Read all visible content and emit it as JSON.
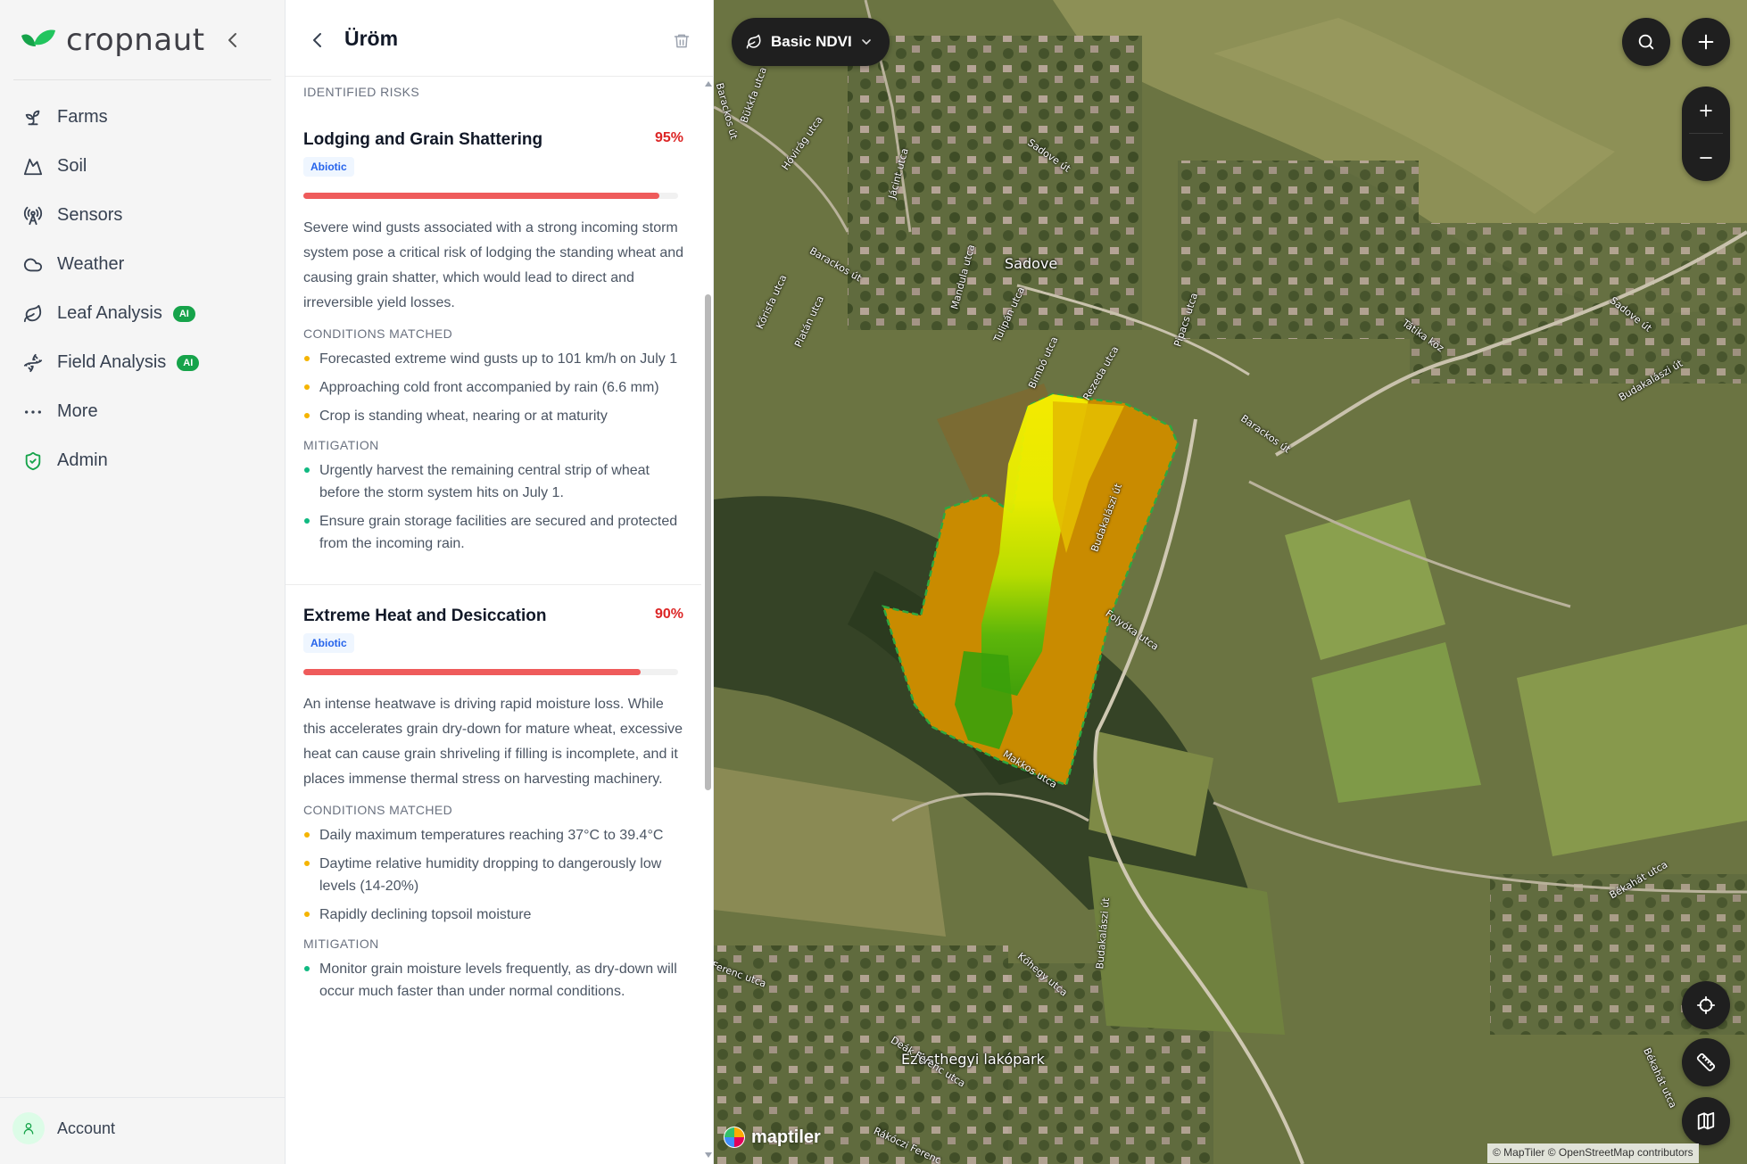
{
  "app": {
    "logo_text": "cropnaut",
    "brand_color": "#16a34a"
  },
  "sidebar": {
    "items": [
      {
        "label": "Farms",
        "icon": "sprout-icon"
      },
      {
        "label": "Soil",
        "icon": "mountain-icon"
      },
      {
        "label": "Sensors",
        "icon": "radio-tower-icon"
      },
      {
        "label": "Weather",
        "icon": "cloud-icon"
      },
      {
        "label": "Leaf Analysis",
        "icon": "leaf-icon",
        "badge": "AI"
      },
      {
        "label": "Field Analysis",
        "icon": "dna-icon",
        "badge": "AI"
      },
      {
        "label": "More",
        "icon": "more-dots-icon"
      },
      {
        "label": "Admin",
        "icon": "shield-check-icon"
      }
    ],
    "account_label": "Account"
  },
  "panel": {
    "title": "Üröm",
    "section_label": "IDENTIFIED RISKS",
    "conditions_label": "CONDITIONS MATCHED",
    "mitigation_label": "MITIGATION",
    "risks": [
      {
        "title": "Lodging and Grain Shattering",
        "percent": "95%",
        "tag": "Abiotic",
        "description": "Severe wind gusts associated with a strong incoming storm system pose a critical risk of lodging the standing wheat and causing grain shatter, which would lead to direct and irreversible yield losses.",
        "conditions": [
          "Forecasted extreme wind gusts up to 101 km/h on July 1",
          "Approaching cold front accompanied by rain (6.6 mm)",
          "Crop is standing wheat, nearing or at maturity"
        ],
        "mitigation": [
          "Urgently harvest the remaining central strip of wheat before the storm system hits on July 1.",
          "Ensure grain storage facilities are secured and protected from the incoming rain."
        ]
      },
      {
        "title": "Extreme Heat and Desiccation",
        "percent": "90%",
        "tag": "Abiotic",
        "description": "An intense heatwave is driving rapid moisture loss. While this accelerates grain dry-down for mature wheat, excessive heat can cause grain shriveling if filling is incomplete, and it places immense thermal stress on harvesting machinery.",
        "conditions": [
          "Daily maximum temperatures reaching 37°C to 39.4°C",
          "Daytime relative humidity dropping to dangerously low levels (14-20%)",
          "Rapidly declining topsoil moisture"
        ],
        "mitigation": [
          "Monitor grain moisture levels frequently, as dry-down will occur much faster than under normal conditions."
        ]
      }
    ]
  },
  "map": {
    "layer_label": "Basic NDVI",
    "attribution": "© MapTiler © OpenStreetMap contributors",
    "logo_text": "maptiler",
    "place_labels": [
      "Sadove",
      "Ezüsthegyi lakópark"
    ],
    "street_labels": [
      "Barackos út",
      "Bükkfa utca",
      "Hóvirág utca",
      "Sadove út",
      "Jácint utca",
      "Barackos út",
      "Mandula utca",
      "Tulipán utca",
      "Kőrisfa utca",
      "Platán utca",
      "Bimbó utca",
      "Rezeda utca",
      "Pipacs utca",
      "Tátika köz",
      "Budakalászi út",
      "Sadove út",
      "Barackos út",
      "Budakalászi út",
      "Folyóka utca",
      "Makkos utca",
      "Budakalászi út",
      "Kőhegy utca",
      "Békahát utca",
      "Deák Ferenc utca",
      "Ferenc utca",
      "Rákóczi Ferenc",
      "Békahát utca"
    ]
  }
}
